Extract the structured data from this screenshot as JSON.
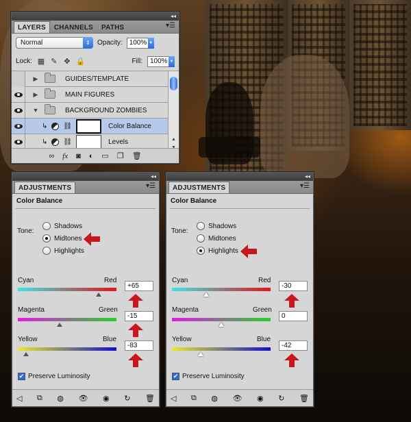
{
  "layers_panel": {
    "tabs": [
      "LAYERS",
      "CHANNELS",
      "PATHS"
    ],
    "blend_mode": "Normal",
    "opacity_label": "Opacity:",
    "opacity": "100%",
    "lock_label": "Lock:",
    "fill_label": "Fill:",
    "fill": "100%",
    "layers": [
      {
        "name": "GUIDES/TEMPLATE",
        "visible": false,
        "type": "group",
        "expanded": false
      },
      {
        "name": "MAIN FIGURES",
        "visible": true,
        "type": "group",
        "expanded": false
      },
      {
        "name": "BACKGROUND ZOMBIES",
        "visible": true,
        "type": "group",
        "expanded": true
      },
      {
        "name": "Color Balance",
        "visible": true,
        "type": "adjustment",
        "selected": true
      },
      {
        "name": "Levels",
        "visible": true,
        "type": "adjustment",
        "selected": false
      }
    ],
    "footer_icons": [
      "link-icon",
      "fx-icon",
      "mask-icon",
      "adjustment-icon",
      "folder-icon",
      "new-layer-icon",
      "trash-icon"
    ]
  },
  "adjustments": [
    {
      "tab": "ADJUSTMENTS",
      "title": "Color Balance",
      "tone_label": "Tone:",
      "tones": [
        "Shadows",
        "Midtones",
        "Highlights"
      ],
      "selected_tone": "Midtones",
      "sliders": [
        {
          "left": "Cyan",
          "right": "Red",
          "value": "+65",
          "position": 0.822
        },
        {
          "left": "Magenta",
          "right": "Green",
          "value": "-15",
          "position": 0.425
        },
        {
          "left": "Yellow",
          "right": "Blue",
          "value": "-83",
          "position": 0.085
        }
      ],
      "preserve_label": "Preserve Luminosity",
      "preserve_checked": true
    },
    {
      "tab": "ADJUSTMENTS",
      "title": "Color Balance",
      "tone_label": "Tone:",
      "tones": [
        "Shadows",
        "Midtones",
        "Highlights"
      ],
      "selected_tone": "Highlights",
      "sliders": [
        {
          "left": "Cyan",
          "right": "Red",
          "value": "-30",
          "position": 0.35
        },
        {
          "left": "Magenta",
          "right": "Green",
          "value": "0",
          "position": 0.5
        },
        {
          "left": "Yellow",
          "right": "Blue",
          "value": "-42",
          "position": 0.29
        }
      ],
      "preserve_label": "Preserve Luminosity",
      "preserve_checked": true
    }
  ],
  "colors": {
    "accent": "#2a6cd8",
    "arrow": "#c8161d",
    "selected_row": "#b6c9ea"
  }
}
